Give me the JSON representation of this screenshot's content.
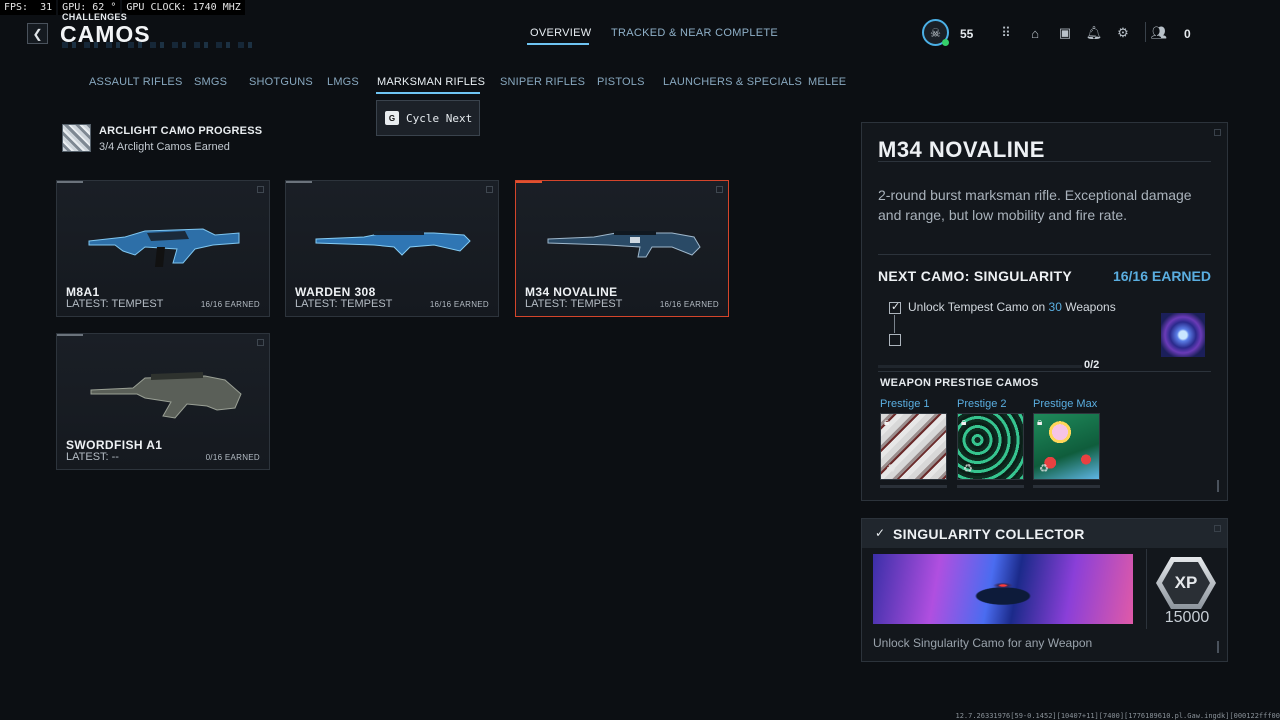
{
  "perf": {
    "fps": "FPS:  31",
    "gpu": "GPU: 62 °",
    "gpu_clock": "GPU CLOCK: 1740 MHZ"
  },
  "header": {
    "section": "CHALLENGES",
    "title": "CAMOS",
    "tabs": [
      {
        "label": "OVERVIEW",
        "active": true
      },
      {
        "label": "TRACKED & NEAR COMPLETE",
        "active": false
      }
    ],
    "level": "55",
    "friends_count": "0"
  },
  "categories": [
    "ASSAULT RIFLES",
    "SMGS",
    "SHOTGUNS",
    "LMGS",
    "MARKSMAN RIFLES",
    "SNIPER RIFLES",
    "PISTOLS",
    "LAUNCHERS & SPECIALS",
    "MELEE"
  ],
  "active_category": "MARKSMAN RIFLES",
  "tooltip": {
    "key": "G",
    "label": "Cycle Next"
  },
  "arclight": {
    "title": "ARCLIGHT CAMO PROGRESS",
    "subtitle": "3/4 Arclight Camos Earned"
  },
  "weapons": [
    {
      "name": "M8A1",
      "latest": "LATEST: TEMPEST",
      "earned": "16/16 EARNED",
      "selected": false
    },
    {
      "name": "WARDEN 308",
      "latest": "LATEST: TEMPEST",
      "earned": "16/16 EARNED",
      "selected": false
    },
    {
      "name": "M34 NOVALINE",
      "latest": "LATEST: TEMPEST",
      "earned": "16/16 EARNED",
      "selected": true
    },
    {
      "name": "SWORDFISH A1",
      "latest": "LATEST: --",
      "earned": "0/16 EARNED",
      "selected": false
    }
  ],
  "detail": {
    "title": "M34 NOVALINE",
    "description": "2-round burst marksman rifle. Exceptional damage and range, but low mobility and fire rate.",
    "next_camo": "NEXT CAMO: SINGULARITY",
    "next_earned": "16/16 EARNED",
    "req_prefix": "Unlock Tempest Camo on ",
    "req_count": "30",
    "req_suffix": " Weapons",
    "sub_progress": "0/2",
    "prestige_title": "WEAPON PRESTIGE CAMOS",
    "prestige": [
      {
        "label": "Prestige 1"
      },
      {
        "label": "Prestige 2"
      },
      {
        "label": "Prestige Max"
      }
    ]
  },
  "collector": {
    "title": "SINGULARITY COLLECTOR",
    "xp_label": "XP",
    "xp_amount": "15000",
    "description": "Unlock Singularity Camo for any Weapon"
  },
  "build": "12.7.26331976[59-0.1452][10407+11][7400][1776189610.pl.Gaw.ingdk][000122fff00"
}
